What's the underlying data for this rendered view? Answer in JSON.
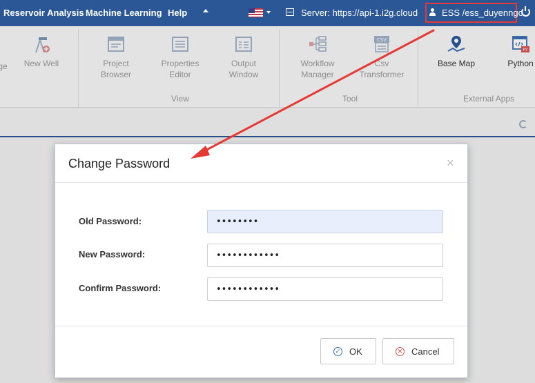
{
  "menu": {
    "items": [
      "Reservoir Analysis",
      "Machine Learning",
      "Help"
    ],
    "server_label": "Server: https://api-1.i2g.cloud",
    "user_label": "ESS /ess_duyenngo"
  },
  "ribbon": {
    "buttons": [
      {
        "label": "ge"
      },
      {
        "label": "New Well"
      },
      {
        "label": "Project\nBrowser"
      },
      {
        "label": "Properties\nEditor"
      },
      {
        "label": "Output\nWindow"
      },
      {
        "label": "Workflow\nManager"
      },
      {
        "label": "Csv\nTransformer"
      },
      {
        "label": "Base Map"
      },
      {
        "label": "Python"
      }
    ],
    "groups": [
      "View",
      "Tool",
      "External Apps"
    ]
  },
  "dialog": {
    "title": "Change Password",
    "close": "×",
    "fields": [
      {
        "label": "Old Password:",
        "value": "••••••••"
      },
      {
        "label": "New Password:",
        "value": "••••••••••••"
      },
      {
        "label": "Confirm Password:",
        "value": "••••••••••••"
      }
    ],
    "ok_label": "OK",
    "cancel_label": "Cancel"
  },
  "colors": {
    "header": "#2b5797",
    "highlight": "#e53935",
    "active_input": "#e8eefc"
  },
  "icons": [
    "user-icon",
    "power-icon",
    "server-icon",
    "flag-icon",
    "check-circle-icon",
    "x-circle-icon",
    "refresh-icon"
  ]
}
